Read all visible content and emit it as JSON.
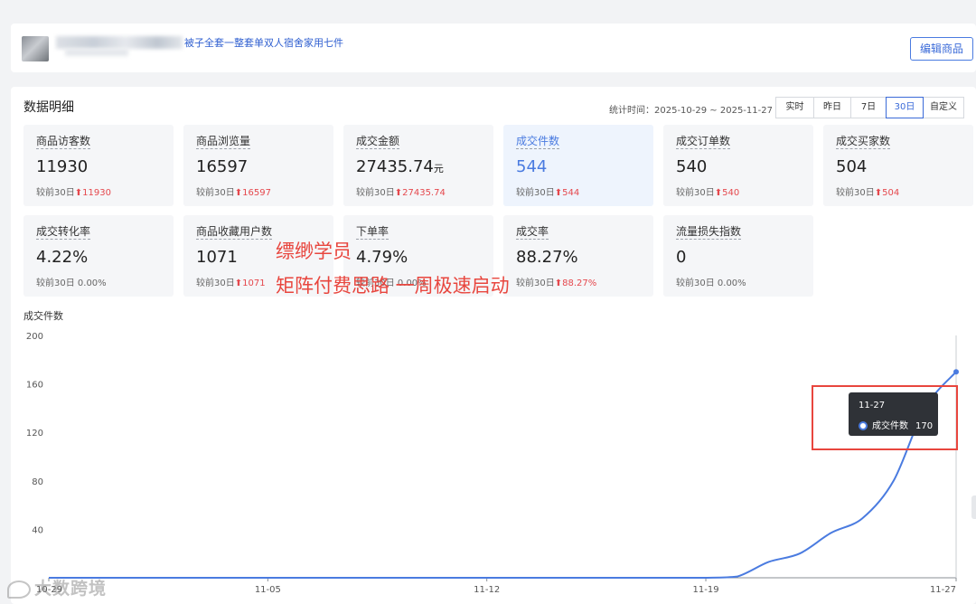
{
  "header": {
    "product_title": "被子全套一整套单双人宿舍家用七件",
    "edit_button": "编辑商品"
  },
  "data_detail": {
    "title": "数据明细",
    "stat_time_label": "统计时间：",
    "stat_time_range": "2025-10-29 ~ 2025-11-27",
    "ranges": [
      "实时",
      "昨日",
      "7日",
      "30日",
      "自定义"
    ],
    "active_range": "30日"
  },
  "metrics": [
    {
      "label": "商品访客数",
      "value": "11930",
      "unit": "",
      "compare": "较前30日",
      "up": true,
      "delta": "11930"
    },
    {
      "label": "商品浏览量",
      "value": "16597",
      "unit": "",
      "compare": "较前30日",
      "up": true,
      "delta": "16597"
    },
    {
      "label": "成交金额",
      "value": "27435.74",
      "unit": "元",
      "compare": "较前30日",
      "up": true,
      "delta": "27435.74"
    },
    {
      "label": "成交件数",
      "value": "544",
      "unit": "",
      "compare": "较前30日",
      "up": true,
      "delta": "544"
    },
    {
      "label": "成交订单数",
      "value": "540",
      "unit": "",
      "compare": "较前30日",
      "up": true,
      "delta": "540"
    },
    {
      "label": "成交买家数",
      "value": "504",
      "unit": "",
      "compare": "较前30日",
      "up": true,
      "delta": "504"
    },
    {
      "label": "成交转化率",
      "value": "4.22%",
      "unit": "",
      "compare": "较前30日 0.00%",
      "up": false,
      "delta": ""
    },
    {
      "label": "商品收藏用户数",
      "value": "1071",
      "unit": "",
      "compare": "较前30日",
      "up": true,
      "delta": "1071"
    },
    {
      "label": "下单率",
      "value": "4.79%",
      "unit": "",
      "compare": "较前30日 0.00%",
      "up": false,
      "delta": ""
    },
    {
      "label": "成交率",
      "value": "88.27%",
      "unit": "",
      "compare": "较前30日",
      "up": true,
      "delta": "88.27%"
    },
    {
      "label": "流量损失指数",
      "value": "0",
      "unit": "",
      "compare": "较前30日 0.00%",
      "up": false,
      "delta": ""
    }
  ],
  "overlay": {
    "line1": "缥缈学员",
    "line2": "矩阵付费思路 一周极速启动"
  },
  "watermark": "大数跨境",
  "chart_label": "成交件数",
  "tooltip": {
    "date": "11-27",
    "series": "成交件数",
    "value": "170"
  },
  "colors": {
    "accent": "#4a7be0",
    "up": "#e5484d",
    "overlay": "#e8463e"
  },
  "chart_data": {
    "type": "line",
    "title": "成交件数",
    "x_tick_labels": [
      "10-29",
      "11-05",
      "11-12",
      "11-19",
      "11-27"
    ],
    "ylim": [
      0,
      200
    ],
    "y_ticks": [
      200,
      160,
      120,
      80,
      40
    ],
    "grid": false,
    "series": [
      {
        "name": "成交件数",
        "x": [
          "10-29",
          "10-30",
          "10-31",
          "11-01",
          "11-02",
          "11-03",
          "11-04",
          "11-05",
          "11-06",
          "11-07",
          "11-08",
          "11-09",
          "11-10",
          "11-11",
          "11-12",
          "11-13",
          "11-14",
          "11-15",
          "11-16",
          "11-17",
          "11-18",
          "11-19",
          "11-20",
          "11-21",
          "11-22",
          "11-23",
          "11-24",
          "11-25",
          "11-26",
          "11-27"
        ],
        "values": [
          0,
          0,
          0,
          0,
          0,
          0,
          0,
          0,
          0,
          0,
          0,
          0,
          0,
          0,
          0,
          0,
          0,
          0,
          0,
          0,
          0,
          0,
          1,
          13,
          20,
          37,
          49,
          80,
          140,
          170
        ]
      }
    ]
  }
}
